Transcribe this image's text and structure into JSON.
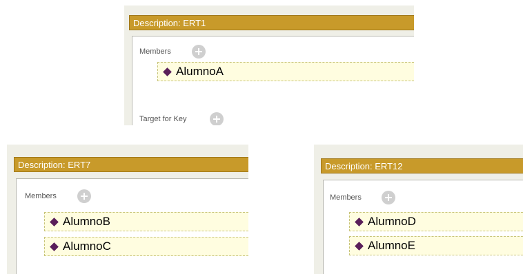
{
  "panels": [
    {
      "header": "Description: ERT1",
      "members_label": "Members",
      "members": [
        "AlumnoA"
      ],
      "target_label": "Target for Key"
    },
    {
      "header": "Description: ERT7",
      "members_label": "Members",
      "members": [
        "AlumnoB",
        "AlumnoC"
      ]
    },
    {
      "header": "Description: ERT12",
      "members_label": "Members",
      "members": [
        "AlumnoD",
        "AlumnoE"
      ]
    }
  ],
  "icons": {
    "add": "add-circle-icon",
    "member": "diamond-icon"
  },
  "colors": {
    "header": "#c89a2a",
    "member_bg": "#fffde0",
    "diamond": "#5a1f5a"
  }
}
